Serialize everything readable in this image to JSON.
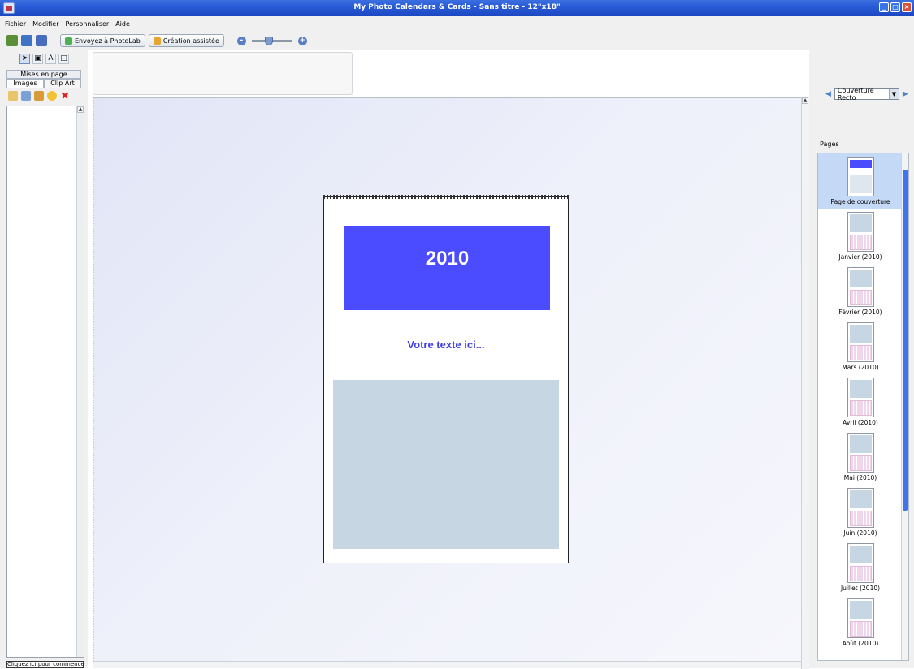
{
  "window": {
    "title": "My Photo Calendars & Cards - Sans titre - 12\"x18\"",
    "controls": [
      "minimize",
      "maximize",
      "close"
    ]
  },
  "menu": [
    "Fichier",
    "Modifier",
    "Personnaliser",
    "Aide"
  ],
  "toolbar": {
    "send_label": "Envoyez à PhotoLab",
    "wizard_label": "Création assistée",
    "zoom_minus": "-",
    "zoom_plus": "+"
  },
  "left_panel": {
    "mises_en_page": "Mises en page",
    "tabs": [
      "Images",
      "Clip Art"
    ],
    "active_tab": "Images",
    "status": "Cliquez ici pour commencer"
  },
  "page": {
    "year": "2010",
    "text_placeholder": "Votre texte ici..."
  },
  "right_panel": {
    "cover_select": "Couverture Recto",
    "pages_label": "Pages",
    "pages": [
      {
        "label": "Page de couverture",
        "kind": "cover",
        "selected": true
      },
      {
        "label": "Janvier (2010)",
        "kind": "month",
        "selected": false
      },
      {
        "label": "Février (2010)",
        "kind": "month",
        "selected": false
      },
      {
        "label": "Mars (2010)",
        "kind": "month",
        "selected": false
      },
      {
        "label": "Avril (2010)",
        "kind": "month",
        "selected": false
      },
      {
        "label": "Mai (2010)",
        "kind": "month",
        "selected": false
      },
      {
        "label": "Juin (2010)",
        "kind": "month",
        "selected": false
      },
      {
        "label": "Juillet (2010)",
        "kind": "month",
        "selected": false
      },
      {
        "label": "Août (2010)",
        "kind": "month",
        "selected": false
      }
    ]
  },
  "colors": {
    "titlebar": "#2a5bd7",
    "year_box": "#4b4bff",
    "placeholder_text": "#4040e0",
    "photo_placeholder": "#c6d6e2",
    "selected_page": "#c4d9f6"
  }
}
